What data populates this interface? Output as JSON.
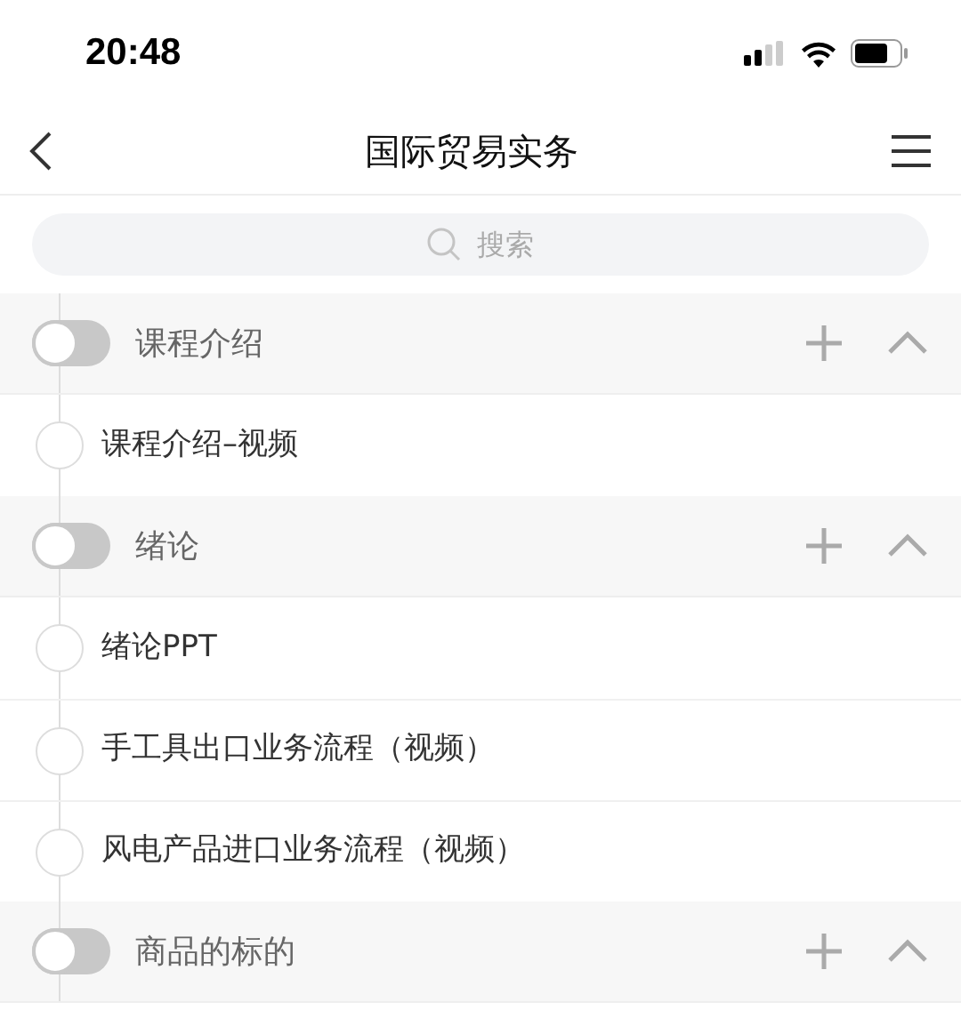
{
  "status_bar": {
    "time": "20:48"
  },
  "nav": {
    "title": "国际贸易实务"
  },
  "search": {
    "placeholder": "搜索"
  },
  "sections": [
    {
      "title": "课程介绍",
      "on": false,
      "expanded": true,
      "items": [
        {
          "title": "课程介绍–视频"
        }
      ]
    },
    {
      "title": "绪论",
      "on": false,
      "expanded": true,
      "items": [
        {
          "title": "绪论PPT"
        },
        {
          "title": "手工具出口业务流程（视频）"
        },
        {
          "title": "风电产品进口业务流程（视频）"
        }
      ]
    },
    {
      "title": "商品的标的",
      "on": false,
      "expanded": true
    }
  ]
}
